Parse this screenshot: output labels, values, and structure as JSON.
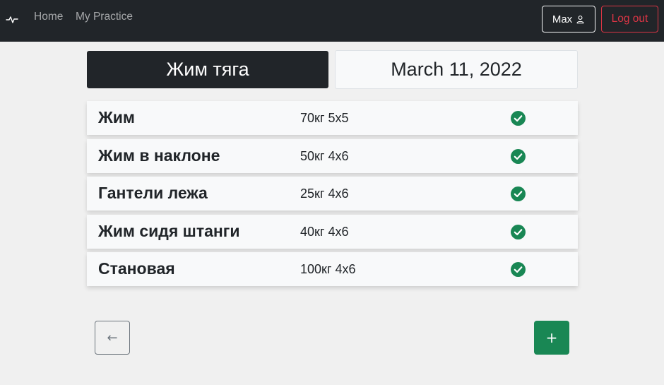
{
  "nav": {
    "brand_icon": "activity-pulse-icon",
    "home_label": "Home",
    "practice_label": "My Practice",
    "user_label": "Max",
    "user_icon": "person-icon",
    "logout_label": "Log out"
  },
  "workout": {
    "title": "Жим тяга",
    "date": "March 11, 2022"
  },
  "exercises": [
    {
      "name": "Жим",
      "weight": "70кг 5x5",
      "done": true
    },
    {
      "name": "Жим в наклоне",
      "weight": "50кг 4x6",
      "done": true
    },
    {
      "name": "Гантели лежа",
      "weight": "25кг 4x6",
      "done": true
    },
    {
      "name": "Жим сидя штанги",
      "weight": "40кг 4x6",
      "done": true
    },
    {
      "name": "Становая",
      "weight": "100кг 4x6",
      "done": true
    }
  ],
  "actions": {
    "back_label": "←",
    "add_label": "+"
  },
  "colors": {
    "navbar": "#212529",
    "success": "#198754",
    "danger": "#dc3545"
  }
}
